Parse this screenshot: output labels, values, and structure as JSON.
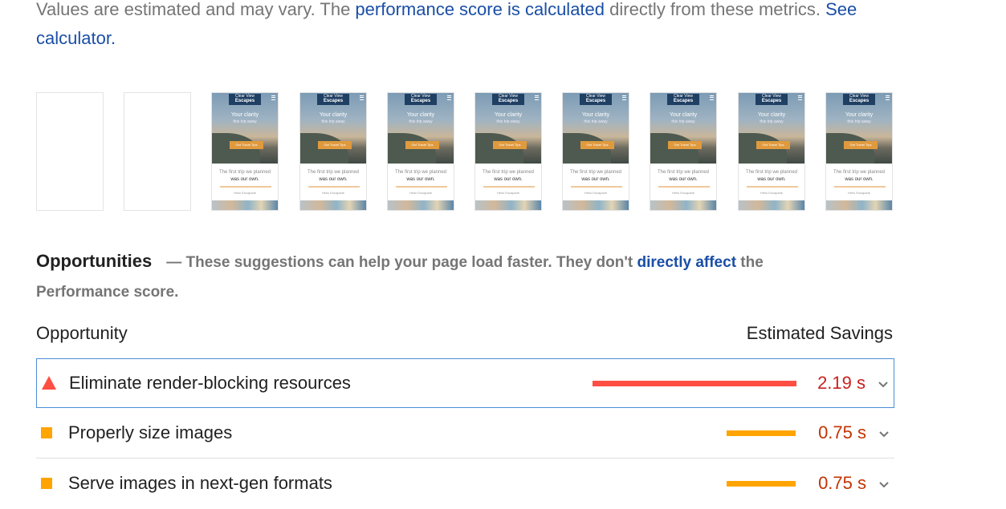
{
  "intro": {
    "text_before": "Values are estimated and may vary. The ",
    "link1": "performance score is calculated",
    "text_middle": " directly from these metrics. ",
    "link2": "See calculator."
  },
  "filmstrip": {
    "blank_frames": 2,
    "frames": [
      {
        "logo_line1": "Clear View",
        "logo_line2": "Escapes",
        "tagline": "Your clarity",
        "tagline2": "this trip away",
        "cta": "Get Travel Tips",
        "body1": "The first trip we planned",
        "body2": "was our own.",
        "sub": "Hello Escapade"
      },
      {
        "logo_line1": "Clear View",
        "logo_line2": "Escapes",
        "tagline": "Your clarity",
        "tagline2": "this trip away",
        "cta": "Get Travel Tips",
        "body1": "The first trip we planned",
        "body2": "was our own.",
        "sub": "Hello Escapade"
      },
      {
        "logo_line1": "Clear View",
        "logo_line2": "Escapes",
        "tagline": "Your clarity",
        "tagline2": "this trip away",
        "cta": "Get Travel Tips",
        "body1": "The first trip we planned",
        "body2": "was our own.",
        "sub": "Hello Escapade"
      },
      {
        "logo_line1": "Clear View",
        "logo_line2": "Escapes",
        "tagline": "Your clarity",
        "tagline2": "this trip away",
        "cta": "Get Travel Tips",
        "body1": "The first trip we planned",
        "body2": "was our own.",
        "sub": "Hello Escapade"
      },
      {
        "logo_line1": "Clear View",
        "logo_line2": "Escapes",
        "tagline": "Your clarity",
        "tagline2": "this trip away",
        "cta": "Get Travel Tips",
        "body1": "The first trip we planned",
        "body2": "was our own.",
        "sub": "Hello Escapade"
      },
      {
        "logo_line1": "Clear View",
        "logo_line2": "Escapes",
        "tagline": "Your clarity",
        "tagline2": "this trip away",
        "cta": "Get Travel Tips",
        "body1": "The first trip we planned",
        "body2": "was our own.",
        "sub": "Hello Escapade"
      },
      {
        "logo_line1": "Clear View",
        "logo_line2": "Escapes",
        "tagline": "Your clarity",
        "tagline2": "this trip away",
        "cta": "Get Travel Tips",
        "body1": "The first trip we planned",
        "body2": "was our own.",
        "sub": "Hello Escapade"
      },
      {
        "logo_line1": "Clear View",
        "logo_line2": "Escapes",
        "tagline": "Your clarity",
        "tagline2": "this trip away",
        "cta": "Get Travel Tips",
        "body1": "The first trip we planned",
        "body2": "was our own.",
        "sub": "Hello Escapade"
      }
    ]
  },
  "opportunities": {
    "title": "Opportunities",
    "desc_before": "— These suggestions can help your page load faster. They don't ",
    "desc_link": "directly affect",
    "desc_after": " the Performance score.",
    "col_left": "Opportunity",
    "col_right": "Estimated Savings",
    "rows": [
      {
        "label": "Eliminate render-blocking resources",
        "savings": "2.19 s",
        "savings_seconds": 2.19,
        "severity": "fail",
        "icon": "red-triangle-icon",
        "bar_color": "#ff4e42",
        "text_color": "#c7221f"
      },
      {
        "label": "Properly size images",
        "savings": "0.75 s",
        "savings_seconds": 0.75,
        "severity": "average",
        "icon": "orange-square-icon",
        "bar_color": "#ffa400",
        "text_color": "#c33300"
      },
      {
        "label": "Serve images in next-gen formats",
        "savings": "0.75 s",
        "savings_seconds": 0.75,
        "severity": "average",
        "icon": "orange-square-icon",
        "bar_color": "#ffa400",
        "text_color": "#c33300"
      }
    ]
  }
}
